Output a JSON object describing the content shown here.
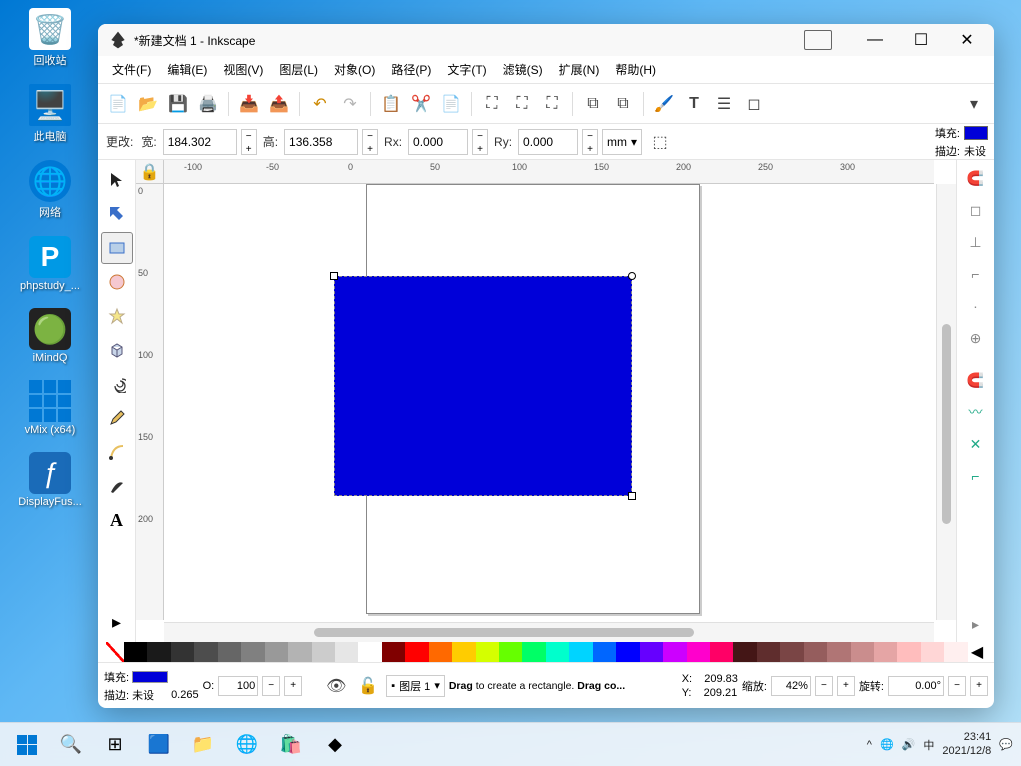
{
  "desktop": {
    "icons": [
      {
        "label": "回收站",
        "type": "recycle"
      },
      {
        "label": "此电脑",
        "type": "pc"
      },
      {
        "label": "网络",
        "type": "net"
      },
      {
        "label": "phpstudy_...",
        "type": "php"
      },
      {
        "label": "iMindQ",
        "type": "imind"
      },
      {
        "label": "vMix (x64)",
        "type": "vmix"
      },
      {
        "label": "DisplayFus...",
        "type": "df"
      }
    ]
  },
  "window": {
    "title": "*新建文档 1 - Inkscape"
  },
  "menu": {
    "file": "文件(F)",
    "edit": "编辑(E)",
    "view": "视图(V)",
    "layer": "图层(L)",
    "object": "对象(O)",
    "path": "路径(P)",
    "text": "文字(T)",
    "filters": "滤镜(S)",
    "extensions": "扩展(N)",
    "help": "帮助(H)"
  },
  "tool_options": {
    "change_label": "更改:",
    "w_label": "宽:",
    "w_value": "184.302",
    "h_label": "高:",
    "h_value": "136.358",
    "rx_label": "Rx:",
    "rx_value": "0.000",
    "ry_label": "Ry:",
    "ry_value": "0.000",
    "unit": "mm",
    "fill_label": "填充:",
    "fill_color": "#0000d9",
    "stroke_label": "描边:",
    "stroke_value": "未设"
  },
  "ruler_h": [
    "-100",
    "-50",
    "0",
    "50",
    "100",
    "150",
    "200",
    "250",
    "300"
  ],
  "ruler_v": [
    "0",
    "50",
    "100",
    "150",
    "200"
  ],
  "palette": [
    "#000000",
    "#1a1a1a",
    "#333333",
    "#4d4d4d",
    "#666666",
    "#808080",
    "#999999",
    "#b3b3b3",
    "#cccccc",
    "#e6e6e6",
    "#ffffff",
    "#800000",
    "#ff0000",
    "#ff6900",
    "#ffcc00",
    "#d4ff00",
    "#66ff00",
    "#00ff66",
    "#00ffcc",
    "#00d4ff",
    "#0066ff",
    "#0000ff",
    "#6600ff",
    "#cc00ff",
    "#ff00cc",
    "#ff0066",
    "#441616",
    "#5f2d2d",
    "#7a4545",
    "#955d5d",
    "#b07575",
    "#ca8d8d",
    "#e5a5a5",
    "#ffbdbd",
    "#ffd6d6",
    "#ffefef"
  ],
  "status": {
    "fill_label": "填充:",
    "fill_color": "#0000d9",
    "stroke_label": "描边:",
    "stroke_value": "未设",
    "stroke_width": "0.265",
    "opacity_label": "O:",
    "opacity": "100",
    "layer_label": "图层 1",
    "hint_drag": "Drag",
    "hint_text1": " to create a rectangle. ",
    "hint_dragco": "Drag co...",
    "x_label": "X:",
    "x_value": "209.83",
    "y_label": "Y:",
    "y_value": "209.21",
    "zoom_label": "缩放:",
    "zoom_value": "42%",
    "rotate_label": "旋转:",
    "rotate_value": "0.00°"
  },
  "taskbar": {
    "ime": "中",
    "time": "23:41",
    "date": "2021/12/8"
  }
}
